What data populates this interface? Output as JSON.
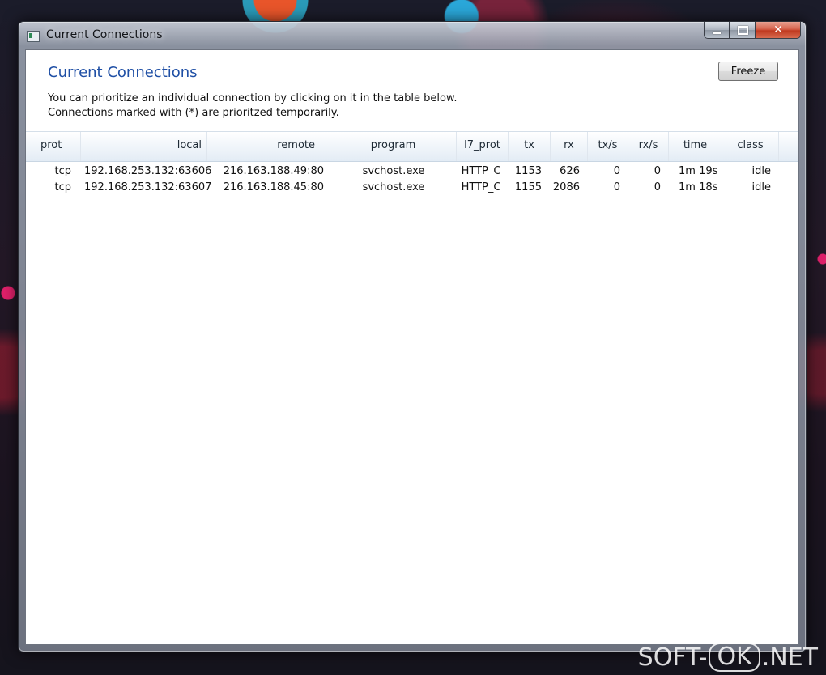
{
  "window": {
    "title": "Current Connections"
  },
  "header": {
    "title": "Current Connections",
    "description_line1": "You can prioritize an individual connection by clicking on it in the table below.",
    "description_line2": "Connections marked with (*) are prioritzed temporarily.",
    "freeze_label": "Freeze"
  },
  "table": {
    "columns": [
      "prot",
      "local",
      "remote",
      "program",
      "l7_prot",
      "tx",
      "rx",
      "tx/s",
      "rx/s",
      "time",
      "class"
    ],
    "rows": [
      [
        "tcp",
        "192.168.253.132:63606",
        "216.163.188.49:80",
        "svchost.exe",
        "HTTP_C",
        "1153",
        "626",
        "0",
        "0",
        "1m 19s",
        "idle"
      ],
      [
        "tcp",
        "192.168.253.132:63607",
        "216.163.188.45:80",
        "svchost.exe",
        "HTTP_C",
        "1155",
        "2086",
        "0",
        "0",
        "1m 18s",
        "idle"
      ]
    ]
  },
  "watermark": {
    "part1": "SOFT-",
    "part2": "OK",
    "part3": ".NET"
  }
}
